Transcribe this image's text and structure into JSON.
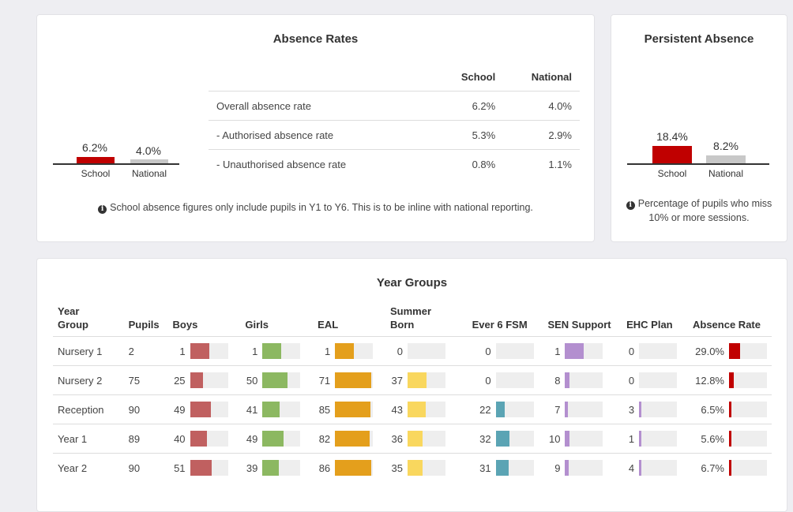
{
  "colors": {
    "school_bar": "#c00000",
    "national_bar": "#c8c8c8",
    "boys": "#c06060",
    "girls": "#8cb861",
    "eal": "#e49f1c",
    "summer_born": "#f9d75e",
    "ever6fsm": "#5ba4b4",
    "sen_support": "#b38fcf",
    "ehc_plan": "#b38fcf",
    "absence_rate": "#c00000"
  },
  "absence_rates": {
    "title": "Absence Rates",
    "chart": {
      "values": [
        {
          "label": "School",
          "value_text": "6.2%",
          "value": 6.2
        },
        {
          "label": "National",
          "value_text": "4.0%",
          "value": 4.0
        }
      ]
    },
    "table": {
      "headers": [
        "",
        "School",
        "National"
      ],
      "rows": [
        {
          "label": "Overall absence rate",
          "school": "6.2%",
          "national": "4.0%"
        },
        {
          "label": "- Authorised absence rate",
          "school": "5.3%",
          "national": "2.9%"
        },
        {
          "label": "- Unauthorised absence rate",
          "school": "0.8%",
          "national": "1.1%"
        }
      ]
    },
    "note": "School absence figures only include pupils in Y1 to Y6. This is to be inline with national reporting."
  },
  "persistent_absence": {
    "title": "Persistent Absence",
    "chart": {
      "values": [
        {
          "label": "School",
          "value_text": "18.4%",
          "value": 18.4
        },
        {
          "label": "National",
          "value_text": "8.2%",
          "value": 8.2
        }
      ]
    },
    "note": "Percentage of pupils who miss 10% or more sessions."
  },
  "year_groups": {
    "title": "Year Groups",
    "headers": {
      "year_group": "Year Group",
      "pupils": "Pupils",
      "boys": "Boys",
      "girls": "Girls",
      "eal": "EAL",
      "summer_born": "Summer Born",
      "ever6fsm": "Ever 6 FSM",
      "sen_support": "SEN Support",
      "ehc_plan": "EHC Plan",
      "absence_rate": "Absence Rate"
    },
    "rows": [
      {
        "name": "Nursery 1",
        "pupils": "2",
        "boys": "1",
        "girls": "1",
        "eal": "1",
        "summer_born": "0",
        "ever6fsm": "0",
        "sen_support": "1",
        "ehc_plan": "0",
        "absence_rate": "29.0%",
        "fractions": {
          "boys": 0.5,
          "girls": 0.5,
          "eal": 0.5,
          "summer_born": 0,
          "ever6fsm": 0,
          "sen_support": 0.5,
          "ehc_plan": 0,
          "absence_rate": 0.29
        }
      },
      {
        "name": "Nursery 2",
        "pupils": "75",
        "boys": "25",
        "girls": "50",
        "eal": "71",
        "summer_born": "37",
        "ever6fsm": "0",
        "sen_support": "8",
        "ehc_plan": "0",
        "absence_rate": "12.8%",
        "fractions": {
          "boys": 0.333,
          "girls": 0.667,
          "eal": 0.947,
          "summer_born": 0.493,
          "ever6fsm": 0,
          "sen_support": 0.107,
          "ehc_plan": 0,
          "absence_rate": 0.128
        }
      },
      {
        "name": "Reception",
        "pupils": "90",
        "boys": "49",
        "girls": "41",
        "eal": "85",
        "summer_born": "43",
        "ever6fsm": "22",
        "sen_support": "7",
        "ehc_plan": "3",
        "absence_rate": "6.5%",
        "fractions": {
          "boys": 0.544,
          "girls": 0.456,
          "eal": 0.944,
          "summer_born": 0.478,
          "ever6fsm": 0.244,
          "sen_support": 0.078,
          "ehc_plan": 0.033,
          "absence_rate": 0.065
        }
      },
      {
        "name": "Year 1",
        "pupils": "89",
        "boys": "40",
        "girls": "49",
        "eal": "82",
        "summer_born": "36",
        "ever6fsm": "32",
        "sen_support": "10",
        "ehc_plan": "1",
        "absence_rate": "5.6%",
        "fractions": {
          "boys": 0.449,
          "girls": 0.551,
          "eal": 0.921,
          "summer_born": 0.404,
          "ever6fsm": 0.36,
          "sen_support": 0.112,
          "ehc_plan": 0.011,
          "absence_rate": 0.056
        }
      },
      {
        "name": "Year 2",
        "pupils": "90",
        "boys": "51",
        "girls": "39",
        "eal": "86",
        "summer_born": "35",
        "ever6fsm": "31",
        "sen_support": "9",
        "ehc_plan": "4",
        "absence_rate": "6.7%",
        "fractions": {
          "boys": 0.567,
          "girls": 0.433,
          "eal": 0.956,
          "summer_born": 0.389,
          "ever6fsm": 0.344,
          "sen_support": 0.1,
          "ehc_plan": 0.044,
          "absence_rate": 0.067
        }
      }
    ]
  }
}
